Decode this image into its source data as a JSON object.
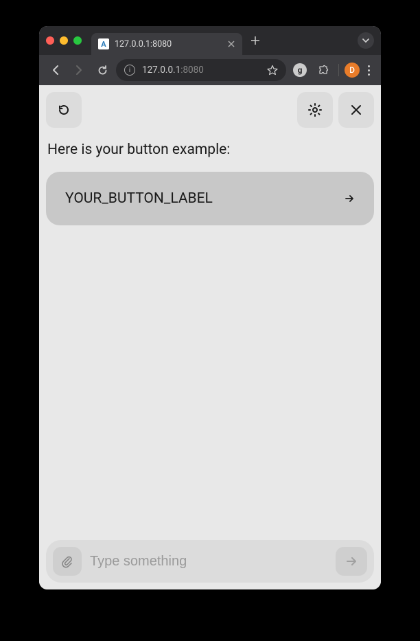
{
  "browser": {
    "tab_title": "127.0.0.1:8080",
    "url_display_dark": "127.0.0.1",
    "url_display_faded": ":8080",
    "avatar_letter": "D",
    "extension_letter": "g"
  },
  "page": {
    "heading": "Here is your button example:",
    "example_button_label": "YOUR_BUTTON_LABEL",
    "input_placeholder": "Type something"
  }
}
